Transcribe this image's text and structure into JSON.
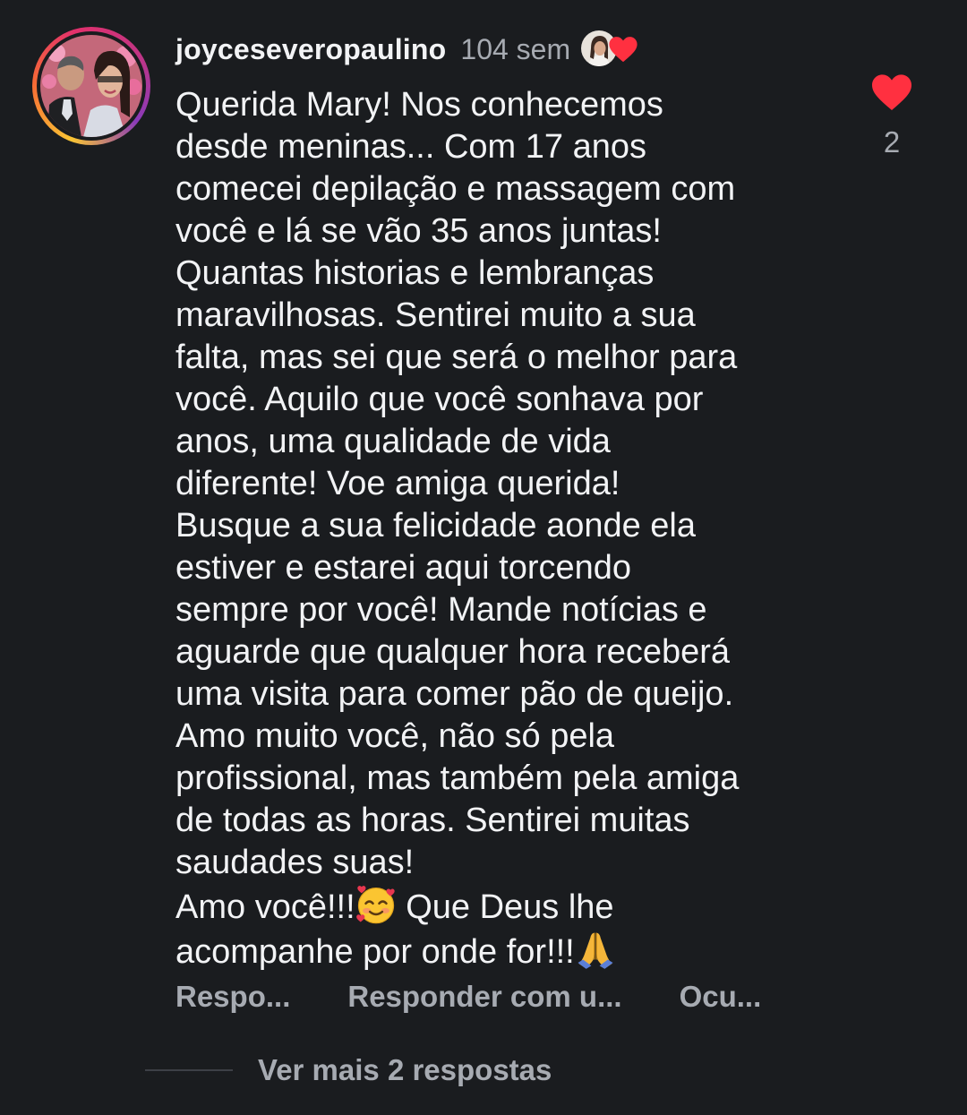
{
  "comment": {
    "username": "joyceseveropaulino",
    "timestamp": "104 sem",
    "author_avatar_icon": "profile-photo-couple",
    "liked_by_author_icon": "author-liked-heart-icon",
    "body_lines": [
      "Querida Mary! Nos conhecemos",
      "desde meninas... Com 17 anos",
      "comecei depilação e massagem com",
      "você e lá se vão 35 anos juntas!",
      "Quantas historias e lembranças",
      "maravilhosas. Sentirei muito a sua",
      "falta, mas sei que será o melhor para",
      "você. Aquilo que você sonhava por",
      "anos, uma qualidade de vida",
      "diferente! Voe amiga querida!",
      "Busque a sua felicidade aonde ela",
      "estiver e estarei aqui torcendo",
      "sempre por você! Mande notícias e",
      "aguarde que qualquer hora receberá",
      "uma visita para comer pão de queijo.",
      "Amo muito você, não só pela",
      "profissional, mas também pela amiga",
      "de todas as horas. Sentirei muitas",
      "saudades suas!"
    ],
    "body_line_20_a": "Amo você!!!",
    "body_line_20_b": " Que Deus lhe",
    "body_line_21": "acompanhe por onde for!!!",
    "emoji_1": "smiling-face-with-hearts",
    "emoji_2": "folded-hands",
    "likes": "2",
    "like_color": "#ff3040"
  },
  "actions": {
    "reply": "Respo...",
    "reply_with": "Responder com u...",
    "hide": "Ocu..."
  },
  "replies": {
    "view_more": "Ver mais 2 respostas"
  },
  "colors": {
    "background": "#1a1c1f",
    "text": "#f2f3f5",
    "muted": "#a7abb2"
  }
}
